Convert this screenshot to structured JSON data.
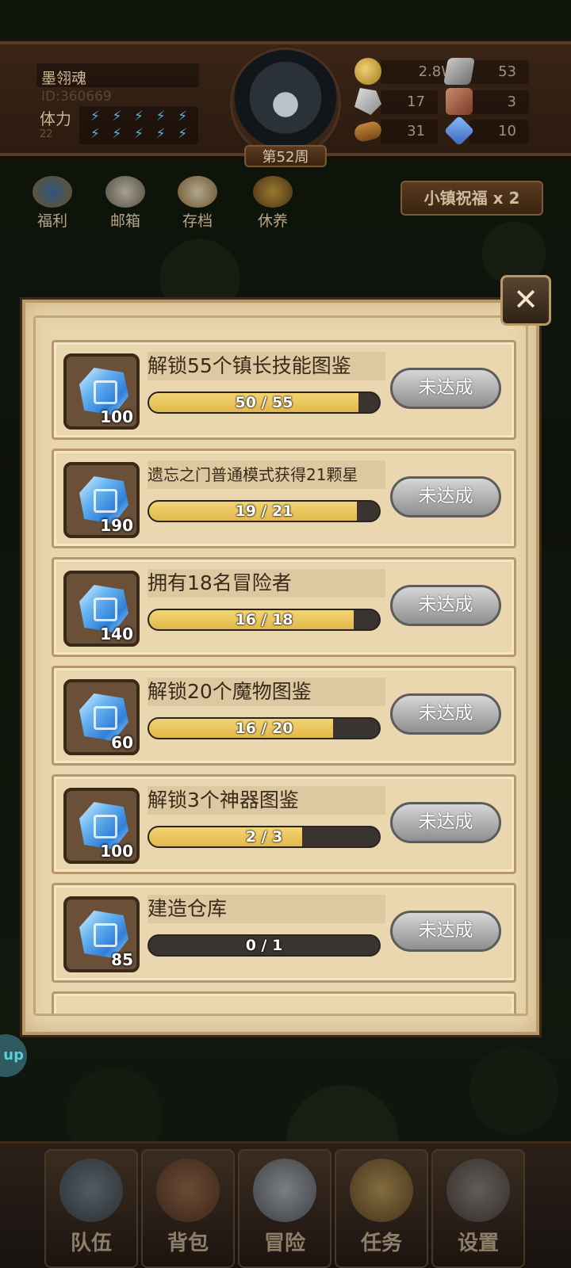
{
  "header": {
    "player_name": "墨翎魂",
    "player_id": "ID:360669",
    "stamina_label": "体力",
    "stamina_value": "22",
    "week_label": "第52周",
    "resources": [
      {
        "icon": "gold-coin-icon",
        "value": "2.8W"
      },
      {
        "icon": "stone-block-icon",
        "value": "53"
      },
      {
        "icon": "ore-icon",
        "value": "17"
      },
      {
        "icon": "scroll-paper-icon",
        "value": "3"
      },
      {
        "icon": "wood-log-icon",
        "value": "31"
      },
      {
        "icon": "blue-cube-icon",
        "value": "10"
      }
    ]
  },
  "quick_menu": [
    {
      "icon": "welfare-shield-icon",
      "label": "福利"
    },
    {
      "icon": "mailbox-icon",
      "label": "邮箱"
    },
    {
      "icon": "save-scroll-icon",
      "label": "存档"
    },
    {
      "icon": "rest-chest-icon",
      "label": "休养"
    }
  ],
  "blessing_label": "小镇祝福 x 2",
  "tasks": [
    {
      "title": "解锁55个镇长技能图鉴",
      "reward_count": "100",
      "progress_text": "50 / 55",
      "progress_fraction": 0.909,
      "status": "未达成"
    },
    {
      "title": "遗忘之门普通模式获得21颗星",
      "reward_count": "190",
      "progress_text": "19 / 21",
      "progress_fraction": 0.905,
      "status": "未达成"
    },
    {
      "title": "拥有18名冒险者",
      "reward_count": "140",
      "progress_text": "16 / 18",
      "progress_fraction": 0.889,
      "status": "未达成"
    },
    {
      "title": "解锁20个魔物图鉴",
      "reward_count": "60",
      "progress_text": "16 / 20",
      "progress_fraction": 0.8,
      "status": "未达成"
    },
    {
      "title": "解锁3个神器图鉴",
      "reward_count": "100",
      "progress_text": "2 / 3",
      "progress_fraction": 0.667,
      "status": "未达成"
    },
    {
      "title": "建造仓库",
      "reward_count": "85",
      "progress_text": "0 / 1",
      "progress_fraction": 0.0,
      "status": "未达成"
    }
  ],
  "side_badge": "up",
  "bottom_nav": [
    {
      "icon": "helmet-icon",
      "label": "队伍"
    },
    {
      "icon": "backpack-icon",
      "label": "背包"
    },
    {
      "icon": "crossed-swords-icon",
      "label": "冒险"
    },
    {
      "icon": "quest-scroll-icon",
      "label": "任务"
    },
    {
      "icon": "gear-icon",
      "label": "设置"
    }
  ],
  "colors": {
    "panel_bg": "#e9d6ae",
    "progress_fill": "#e2b84a",
    "button_gray": "#a8a8a8",
    "gem_blue": "#6ab4f0"
  }
}
